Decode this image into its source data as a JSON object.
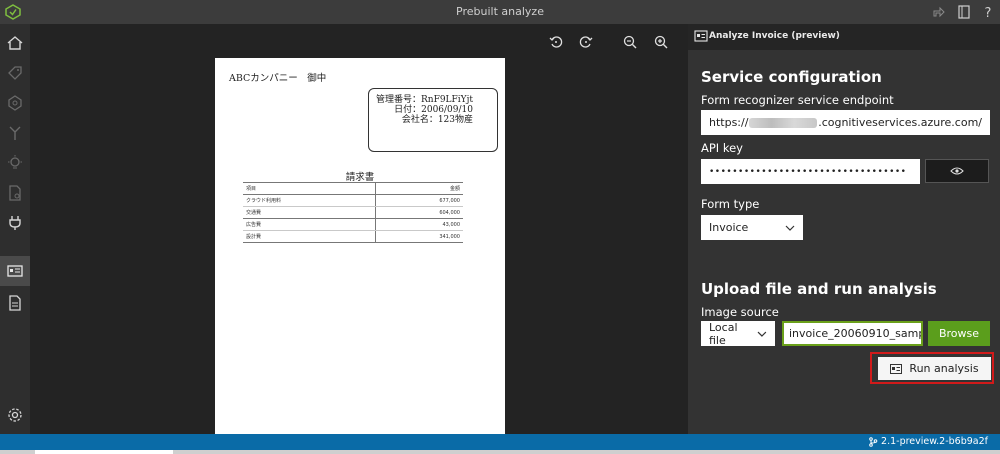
{
  "window": {
    "title": "Prebuilt analyze"
  },
  "sidebar": {
    "items": [
      {
        "icon": "home-icon",
        "active": false
      },
      {
        "icon": "tag-icon",
        "active": false
      },
      {
        "icon": "model-compose-icon",
        "active": false
      },
      {
        "icon": "merge-icon",
        "active": false
      },
      {
        "icon": "lightbulb-icon",
        "active": false
      },
      {
        "icon": "document-search-icon",
        "active": false
      },
      {
        "icon": "plug-icon",
        "active": false
      },
      {
        "icon": "id-card-icon",
        "active": true
      },
      {
        "icon": "layout-document-icon",
        "active": false
      },
      {
        "icon": "settings-icon",
        "active": false
      }
    ]
  },
  "viewer": {
    "tools": [
      "rotate-left-icon",
      "rotate-right-icon",
      "zoom-out-icon",
      "zoom-in-icon"
    ]
  },
  "document": {
    "company": "ABCカンパニー　御中",
    "info": [
      "管理番号：RnF9LFiYjt",
      "日付：2006/09/10",
      "会社名：123物産"
    ],
    "title": "請求書",
    "table": {
      "headers": [
        "項目",
        "金額"
      ],
      "rows": [
        [
          "クラウド利用料",
          "677,000"
        ],
        [
          "交通費",
          "604,000"
        ],
        [
          "広告費",
          "43,000"
        ],
        [
          "設計費",
          "341,000"
        ]
      ]
    }
  },
  "panel": {
    "header_title": "Analyze Invoice (preview)",
    "service_config": {
      "heading": "Service configuration",
      "endpoint_label": "Form recognizer service endpoint",
      "endpoint_prefix": "https://",
      "endpoint_suffix": ".cognitiveservices.azure.com/",
      "apikey_label": "API key",
      "apikey_value": "••••••••••••••••••••••••••••••••••"
    },
    "form_type": {
      "label": "Form type",
      "value": "Invoice"
    },
    "upload": {
      "heading": "Upload file and run analysis",
      "source_label": "Image source",
      "source_value": "Local file",
      "file_name": "invoice_20060910_samp...",
      "browse_label": "Browse",
      "run_label": "Run analysis"
    }
  },
  "status": {
    "version": "2.1-preview.2-b6b9a2f"
  },
  "colors": {
    "accent_green": "#5b9e1c",
    "status_blue": "#0a6ba7",
    "highlight_red": "#d11a1a"
  }
}
